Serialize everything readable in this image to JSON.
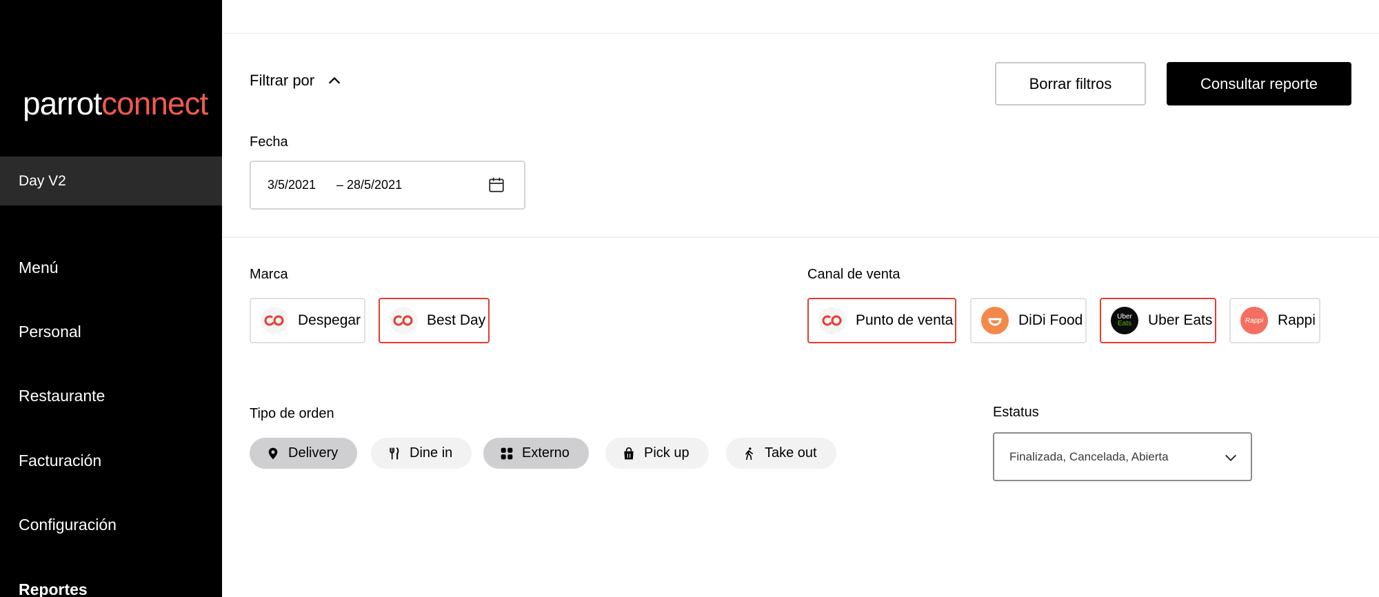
{
  "sidebar": {
    "logo": {
      "part1": "parrot",
      "part2": "connect"
    },
    "store": "Day V2",
    "nav": [
      "Menú",
      "Personal",
      "Restaurante",
      "Facturación",
      "Configuración",
      "Reportes"
    ]
  },
  "filters": {
    "toggle_label": "Filtrar por",
    "clear_label": "Borrar filtros",
    "submit_label": "Consultar reporte",
    "date": {
      "label": "Fecha",
      "start": "3/5/2021",
      "end": "– 28/5/2021"
    },
    "brand": {
      "label": "Marca",
      "items": [
        {
          "name": "Despegar",
          "selected": false
        },
        {
          "name": "Best Day",
          "selected": true
        }
      ]
    },
    "channel": {
      "label": "Canal de venta",
      "items": [
        {
          "name": "Punto de venta",
          "selected": true
        },
        {
          "name": "DiDi Food",
          "selected": false
        },
        {
          "name": "Uber Eats",
          "selected": true,
          "logo_text": [
            "Uber",
            "Eats"
          ]
        },
        {
          "name": "Rappi",
          "selected": false,
          "logo_text": "Rappi"
        }
      ]
    },
    "order_type": {
      "label": "Tipo de orden",
      "items": [
        {
          "name": "Delivery",
          "selected": true,
          "icon": "location-pin-icon"
        },
        {
          "name": "Dine in",
          "selected": false,
          "icon": "fork-knife-icon"
        },
        {
          "name": "Externo",
          "selected": true,
          "icon": "grid-icon"
        },
        {
          "name": "Pick up",
          "selected": false,
          "icon": "shopping-bag-icon"
        },
        {
          "name": "Take out",
          "selected": false,
          "icon": "walking-person-icon"
        }
      ]
    },
    "status": {
      "label": "Estatus",
      "value": "Finalizada, Cancelada, Abierta"
    }
  },
  "colors": {
    "accent": "#e63b2e",
    "logo_accent": "#f05a4f",
    "sidebar_bg": "#000000"
  }
}
